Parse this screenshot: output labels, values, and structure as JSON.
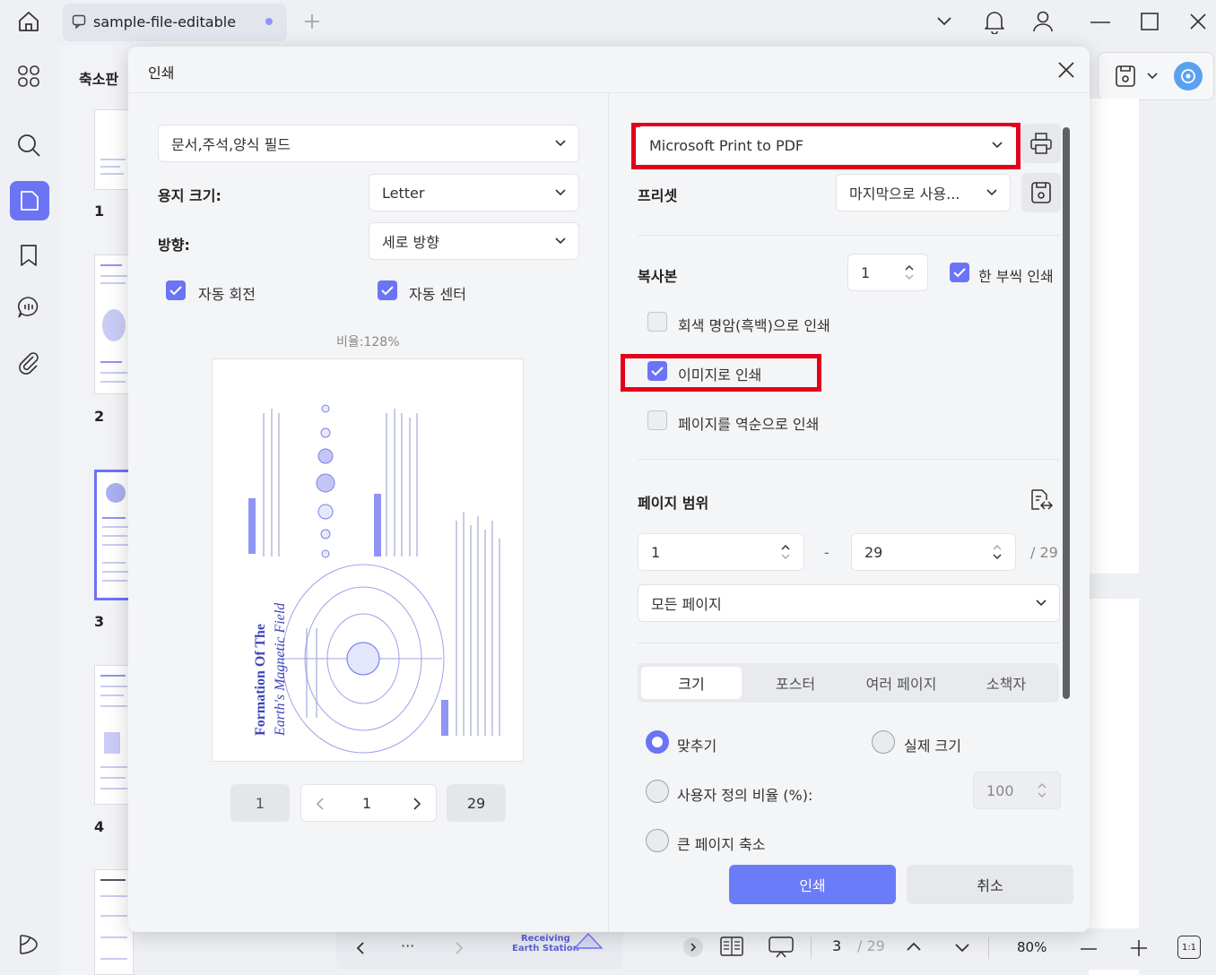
{
  "tab": {
    "title": "sample-file-editable"
  },
  "thumbnails": {
    "title": "축소판",
    "pages": [
      "1",
      "2",
      "3",
      "4"
    ]
  },
  "dialog": {
    "title": "인쇄",
    "content_select": "문서,주석,양식 필드",
    "paper_size_label": "용지 크기:",
    "paper_size_value": "Letter",
    "orientation_label": "방향:",
    "orientation_value": "세로 방향",
    "auto_rotate_label": "자동 회전",
    "auto_center_label": "자동 센터",
    "scale_text": "비율:128%",
    "preview_nav": {
      "first": "1",
      "current": "1",
      "last": "29"
    },
    "preview_doc": {
      "title_line1": "Formation Of The",
      "title_line2": "Earth's Magnetic Field"
    },
    "printer_value": "Microsoft Print to PDF",
    "preset_label": "프리셋",
    "preset_value": "마지막으로 사용...",
    "copies_label": "복사본",
    "copies_value": "1",
    "collate_label": "한 부씩 인쇄",
    "grayscale_label": "회색 명암(흑백)으로 인쇄",
    "print_as_image_label": "이미지로 인쇄",
    "reverse_label": "페이지를 역순으로 인쇄",
    "page_range_label": "페이지 범위",
    "range_from": "1",
    "range_dash": "-",
    "range_to": "29",
    "range_total": "/ 29",
    "pages_select": "모든 페이지",
    "tabs": [
      "크기",
      "포스터",
      "여러 페이지",
      "소책자"
    ],
    "fit_label": "맞추기",
    "actual_size_label": "실제 크기",
    "custom_scale_label": "사용자 정의 비율 (%):",
    "custom_scale_value": "100",
    "shrink_label": "큰 페이지 축소",
    "print_button": "인쇄",
    "cancel_button": "취소"
  },
  "bottombar": {
    "dots": "···",
    "label_line1": "Receiving",
    "label_line2": "Earth Station",
    "page_current": "3",
    "page_total": "/ 29",
    "zoom": "80%",
    "ratio": "1:1"
  },
  "colors": {
    "accent": "#6b74f5",
    "highlight_red": "#e3001b"
  }
}
